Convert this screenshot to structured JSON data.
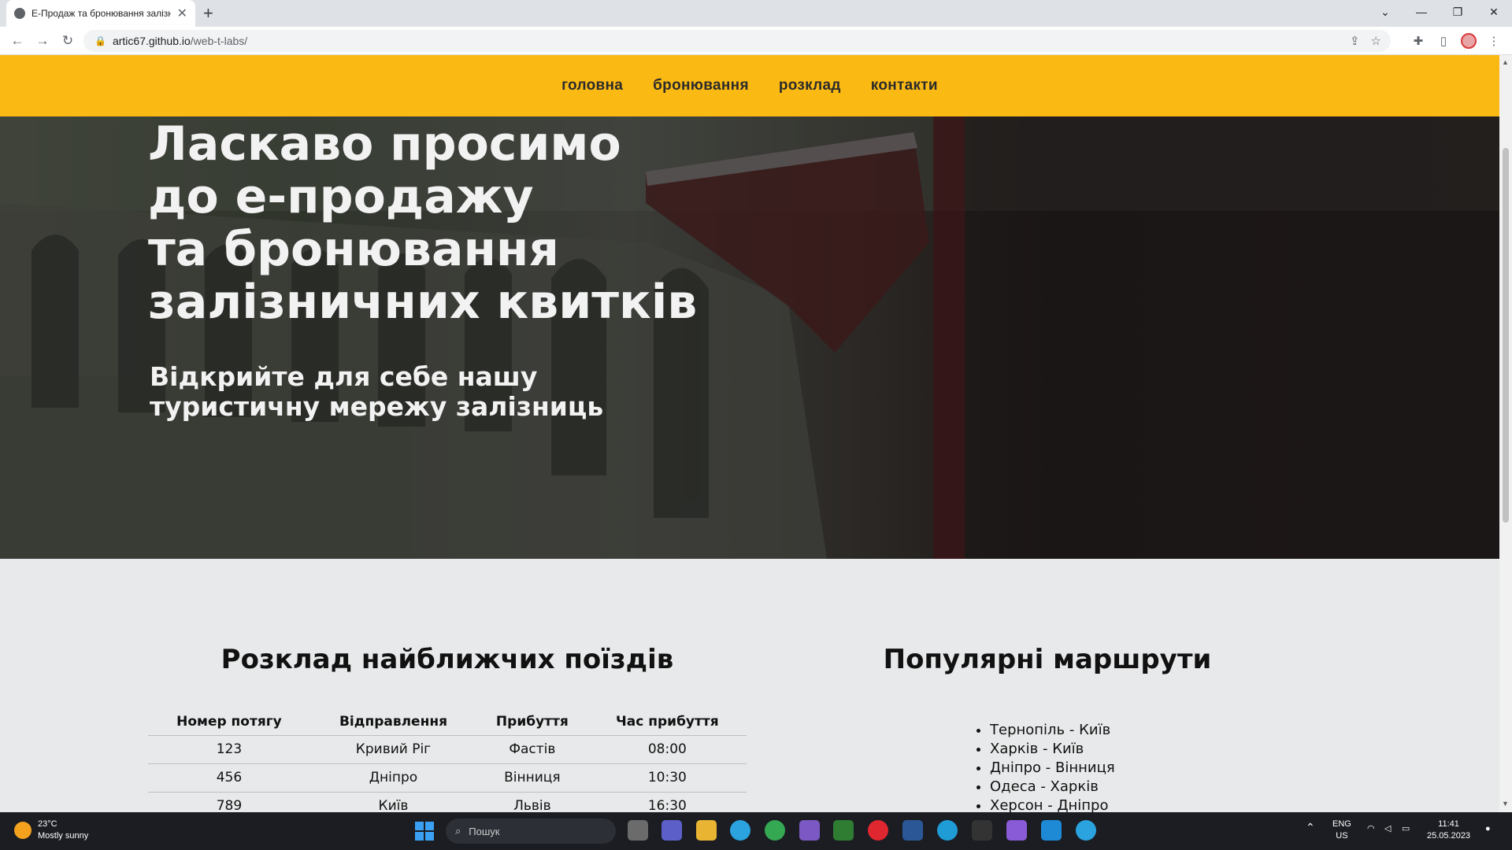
{
  "browser": {
    "tab_title": "Е-Продаж та бронювання залізни",
    "url_host": "artic67.github.io",
    "url_path": "/web-t-labs/"
  },
  "site": {
    "nav": [
      "головна",
      "бронювання",
      "розклад",
      "контакти"
    ],
    "hero_title_lines": [
      "Ласкаво просимо",
      "до е-продажу",
      "та бронювання",
      "залізничних квитків"
    ],
    "hero_subtitle_lines": [
      "Відкрийте для себе нашу",
      "туристичну мережу залізниць"
    ],
    "schedule": {
      "title": "Розклад найближчих поїздів",
      "headers": [
        "Номер потягу",
        "Відправлення",
        "Прибуття",
        "Час прибуття"
      ],
      "rows": [
        [
          "123",
          "Кривий Ріг",
          "Фастів",
          "08:00"
        ],
        [
          "456",
          "Дніпро",
          "Вінниця",
          "10:30"
        ],
        [
          "789",
          "Київ",
          "Львів",
          "16:30"
        ]
      ]
    },
    "routes": {
      "title": "Популярні маршрути",
      "items": [
        "Тернопіль - Київ",
        "Харків - Київ",
        "Дніпро - Вінниця",
        "Одеса - Харків",
        "Херсон - Дніпро"
      ]
    }
  },
  "taskbar": {
    "weather_temp": "23°C",
    "weather_desc": "Mostly sunny",
    "search_placeholder": "Пошук",
    "lang_line1": "ENG",
    "lang_line2": "US",
    "time": "11:41",
    "date": "25.05.2023"
  },
  "colors": {
    "nav_bg": "#fbb914",
    "page_bg": "#e8e9ea",
    "taskbar_bg": "#1b1d22"
  },
  "icons": [
    "back-icon",
    "forward-icon",
    "reload-icon",
    "lock-icon",
    "share-icon",
    "star-icon",
    "extensions-icon",
    "sidepanel-icon",
    "menu-icon"
  ]
}
